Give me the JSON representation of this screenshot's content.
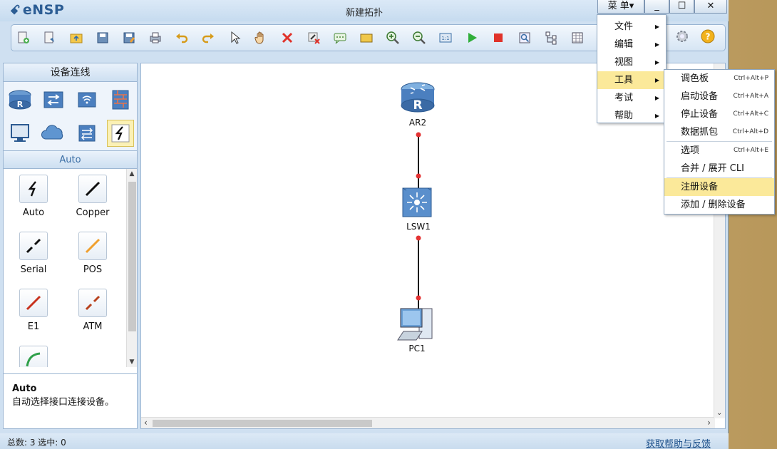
{
  "app": {
    "logo": "eNSP",
    "window_title": "新建拓扑"
  },
  "window_controls": {
    "menu": "菜 单▾",
    "minimize": "_",
    "maximize": "☐",
    "close": "✕"
  },
  "left_panel": {
    "header": "设备连线",
    "selected_category": "Auto",
    "devices": [
      {
        "label": "Auto",
        "color": "#111111"
      },
      {
        "label": "Copper",
        "color": "#111111"
      },
      {
        "label": "Serial",
        "color": "#111111"
      },
      {
        "label": "POS",
        "color": "#f0a030"
      },
      {
        "label": "E1",
        "color": "#c8321e"
      },
      {
        "label": "ATM",
        "color": "#b8421e"
      }
    ],
    "description": {
      "title": "Auto",
      "text": "自动选择接口连接设备。"
    }
  },
  "topology": {
    "nodes": [
      {
        "label": "AR2",
        "type": "router"
      },
      {
        "label": "LSW1",
        "type": "switch"
      },
      {
        "label": "PC1",
        "type": "pc"
      }
    ],
    "link_endpoint_color": "#e33333"
  },
  "status": {
    "left": "总数: 3  选中: 0",
    "help_link": "获取帮助与反馈"
  },
  "main_menu": {
    "items": [
      {
        "label": "文件"
      },
      {
        "label": "编辑"
      },
      {
        "label": "视图"
      },
      {
        "label": "工具"
      },
      {
        "label": "考试"
      },
      {
        "label": "帮助"
      }
    ],
    "active": "工具"
  },
  "tools_submenu": {
    "items": [
      {
        "label": "调色板",
        "shortcut": "Ctrl+Alt+P"
      },
      {
        "label": "启动设备",
        "shortcut": "Ctrl+Alt+A"
      },
      {
        "label": "停止设备",
        "shortcut": "Ctrl+Alt+C"
      },
      {
        "label": "数据抓包",
        "shortcut": "Ctrl+Alt+D"
      },
      {
        "label": "选项",
        "shortcut": "Ctrl+Alt+E"
      },
      {
        "label": "合并 / 展开 CLI",
        "shortcut": ""
      },
      {
        "label": "注册设备",
        "shortcut": ""
      },
      {
        "label": "添加 / 删除设备",
        "shortcut": ""
      }
    ],
    "active": "注册设备"
  },
  "colors": {
    "accent": "#2c5d94",
    "highlight": "#fbe99a",
    "panel": "#cfe0f1"
  }
}
